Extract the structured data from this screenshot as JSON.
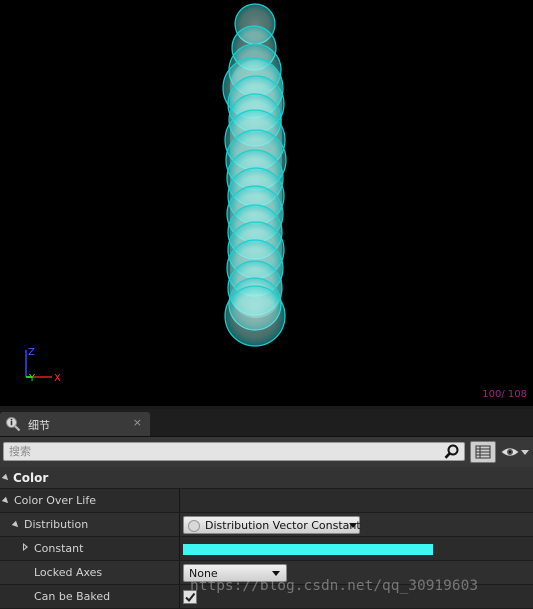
{
  "viewport": {
    "particle_count": "100/ 108",
    "particle_color": "#b3fff8",
    "particle_rim_color": "#1ecfcf",
    "axis_labels": {
      "z": "Z",
      "y": "Y",
      "x": "X"
    }
  },
  "details": {
    "tab_label": "细节",
    "tab_close": "×",
    "search_placeholder": "搜索",
    "category": "Color",
    "properties": [
      {
        "label": "Color Over Life"
      },
      {
        "label": "Distribution",
        "value": "Distribution Vector Constant"
      },
      {
        "label": "Constant",
        "swatch_color": "#3ef6f2"
      },
      {
        "label": "Locked Axes",
        "value": "None"
      },
      {
        "label": "Can be Baked",
        "checked": true
      }
    ]
  },
  "watermark": "https://blog.csdn.net/qq_30919603"
}
